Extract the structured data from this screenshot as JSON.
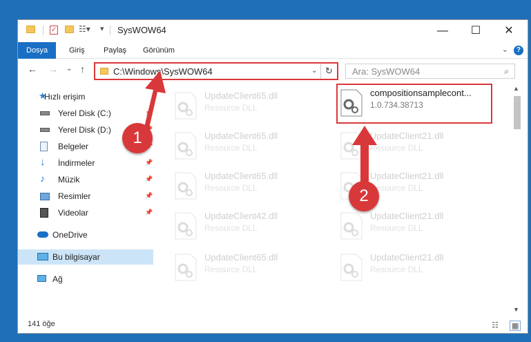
{
  "title": "SysWOW64",
  "ribbon_tabs": [
    "Dosya",
    "Giriş",
    "Paylaş",
    "Görünüm"
  ],
  "address": {
    "path": "C:\\Windows\\SysWOW64"
  },
  "search": {
    "placeholder": "Ara: SysWOW64"
  },
  "sidebar": {
    "items": [
      {
        "label": "Hızlı erişim",
        "icon": "star-icon"
      },
      {
        "label": "Yerel Disk (C:)",
        "icon": "drive-icon",
        "pinned": true
      },
      {
        "label": "Yerel Disk (D:)",
        "icon": "drive-icon",
        "pinned": true
      },
      {
        "label": "Belgeler",
        "icon": "document-icon",
        "pinned": true
      },
      {
        "label": "İndirmeler",
        "icon": "download-icon",
        "pinned": true
      },
      {
        "label": "Müzik",
        "icon": "music-icon",
        "pinned": true
      },
      {
        "label": "Resimler",
        "icon": "picture-icon",
        "pinned": true
      },
      {
        "label": "Videolar",
        "icon": "video-icon",
        "pinned": true
      },
      {
        "label": "OneDrive",
        "icon": "cloud-icon"
      },
      {
        "label": "Bu bilgisayar",
        "icon": "computer-icon",
        "selected": true
      },
      {
        "label": "Ağ",
        "icon": "network-icon"
      }
    ]
  },
  "files": {
    "left": [
      {
        "name": "UpdateClient65.dll",
        "type": "Resource DLL"
      },
      {
        "name": "UpdateClient65.dll",
        "type": "Resource DLL"
      },
      {
        "name": "UpdateClient65.dll",
        "type": "Resource DLL"
      },
      {
        "name": "UpdateClient42.dll",
        "type": "Resource DLL"
      },
      {
        "name": "UpdateClient65.dll",
        "type": "Resource DLL"
      }
    ],
    "right": [
      {
        "name": "compositionsamplecont...",
        "type": "1.0.734.38713"
      },
      {
        "name": "UpdateClient21.dll",
        "type": "Resource DLL"
      },
      {
        "name": "UpdateClient21.dll",
        "type": "Resource DLL"
      },
      {
        "name": "UpdateClient21.dll",
        "type": "Resource DLL"
      },
      {
        "name": "UpdateClient21.dll",
        "type": "Resource DLL"
      }
    ]
  },
  "status": {
    "count": "141 öğe"
  },
  "annotations": {
    "step1": "1",
    "step2": "2"
  },
  "colors": {
    "accent": "#1a6fc4",
    "highlight": "#d9383a",
    "desktop": "#1f6fb8"
  }
}
